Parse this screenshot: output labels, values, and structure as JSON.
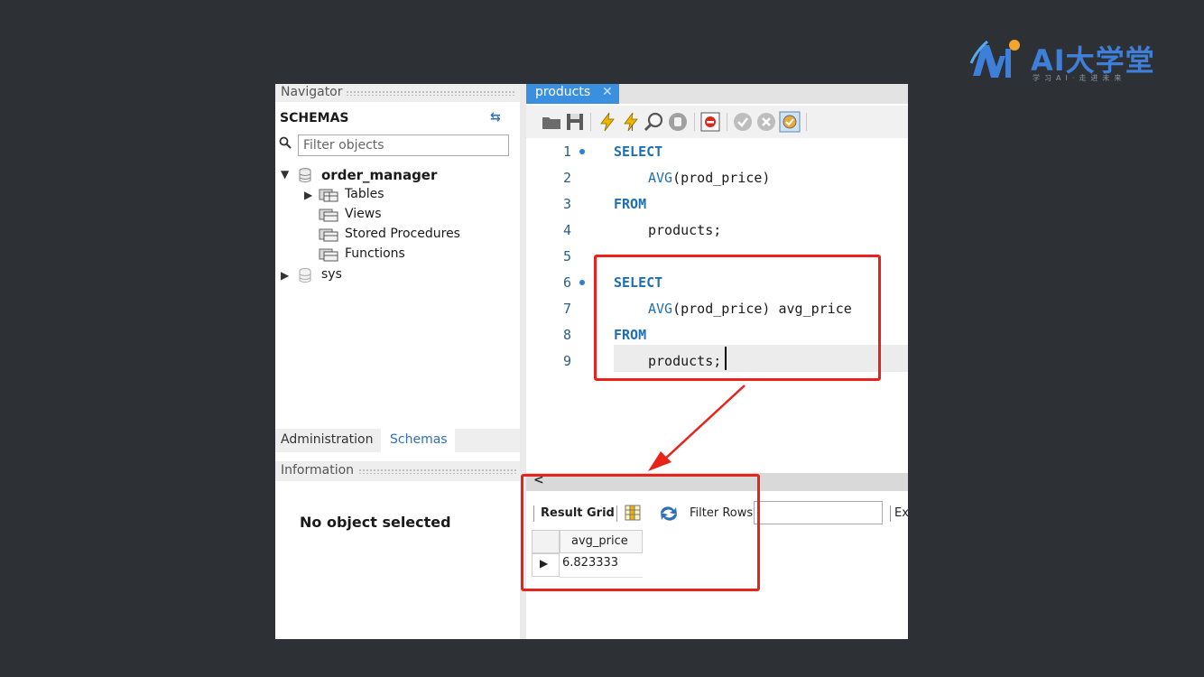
{
  "brand": {
    "name": "AI大学堂",
    "tagline": "学习AI·走进未来"
  },
  "navigator": {
    "title": "Navigator",
    "schemas_title": "SCHEMAS",
    "filter_placeholder": "Filter objects",
    "tree": [
      {
        "label": "order_manager",
        "type": "database",
        "expanded": true,
        "children": [
          {
            "label": "Tables",
            "expandable": true
          },
          {
            "label": "Views"
          },
          {
            "label": "Stored Procedures"
          },
          {
            "label": "Functions"
          }
        ]
      },
      {
        "label": "sys",
        "type": "database",
        "expanded": false
      }
    ],
    "tabs": [
      "Administration",
      "Schemas"
    ],
    "active_tab": "Schemas",
    "information_title": "Information",
    "no_object": "No object selected"
  },
  "editor": {
    "tab_label": "products",
    "lines": [
      {
        "num": "1",
        "bullet": true,
        "kw": "SELECT"
      },
      {
        "num": "2",
        "fn": "AVG",
        "text": "(prod_price)"
      },
      {
        "num": "3",
        "kw": "FROM"
      },
      {
        "num": "4",
        "text": "products;"
      },
      {
        "num": "5"
      },
      {
        "num": "6",
        "bullet": true,
        "kw": "SELECT"
      },
      {
        "num": "7",
        "fn": "AVG",
        "text": "(prod_price) avg_price"
      },
      {
        "num": "8",
        "kw": "FROM"
      },
      {
        "num": "9",
        "text": "products;"
      }
    ]
  },
  "result": {
    "grid_label": "Result Grid",
    "filter_label": "Filter Rows:",
    "export_label": "Ex",
    "column": "avg_price",
    "value": "6.823333"
  },
  "colors": {
    "highlight": "#e8231a",
    "keyword": "#1f6fb0",
    "active_tab": "#3a8fde",
    "background": "#2d3136"
  }
}
